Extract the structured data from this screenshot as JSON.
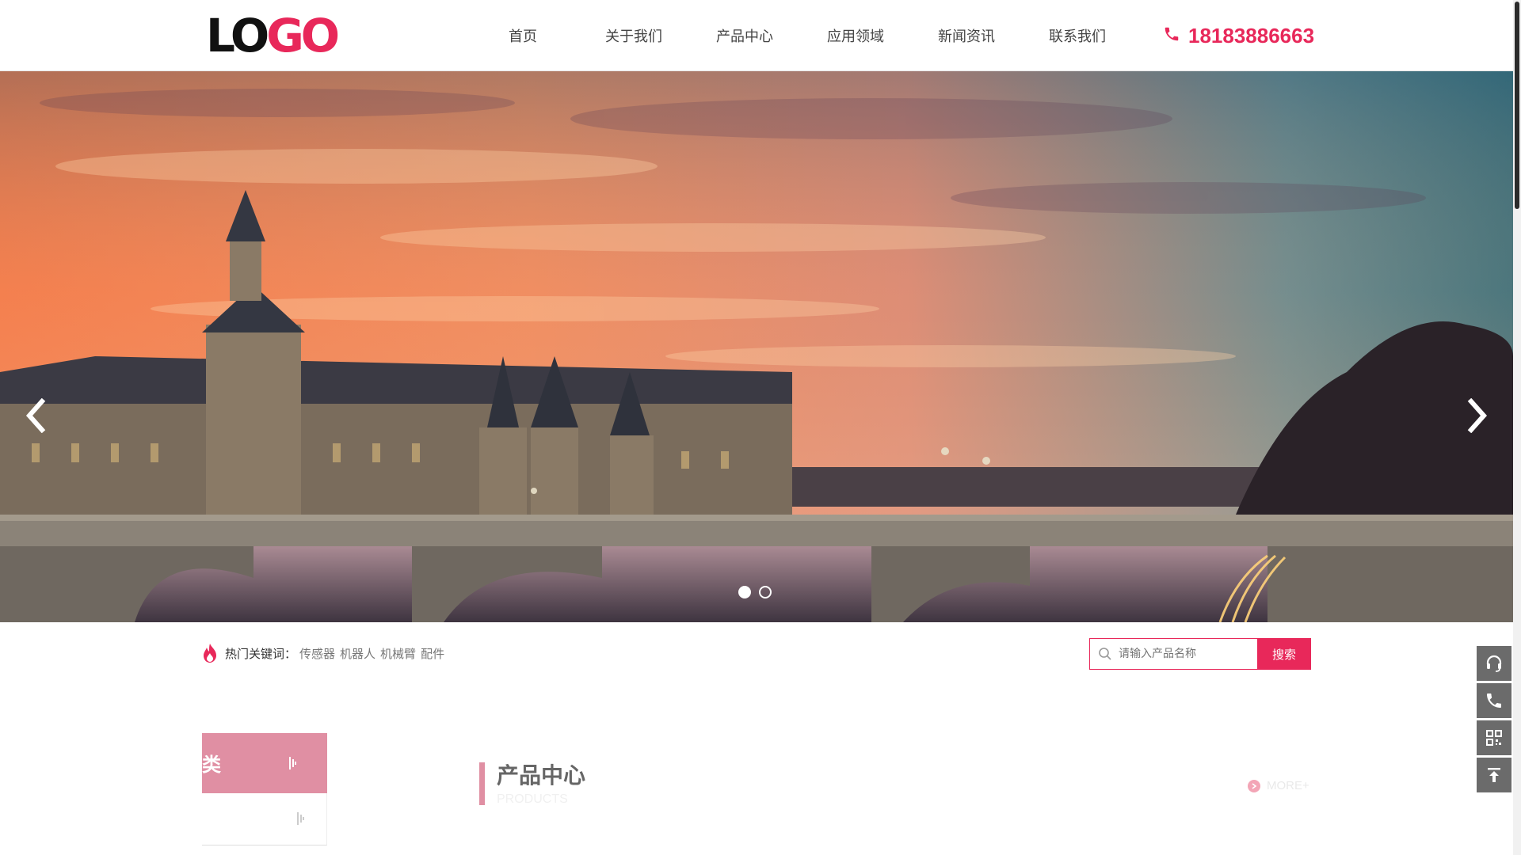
{
  "header": {
    "logo": {
      "part1": "LO",
      "part2": "GO"
    },
    "nav": [
      {
        "label": "首页"
      },
      {
        "label": "关于我们"
      },
      {
        "label": "产品中心"
      },
      {
        "label": "应用领域"
      },
      {
        "label": "新闻资讯"
      },
      {
        "label": "联系我们"
      }
    ],
    "phone": "18183886663"
  },
  "banner": {
    "prev_icon": "chevron-left-icon",
    "next_icon": "chevron-right-icon",
    "slide_count": 2,
    "active_slide": 1
  },
  "hot_keywords": {
    "label": "热门关键词：",
    "items": [
      "传感器",
      "机器人",
      "机械臂",
      "配件"
    ]
  },
  "search": {
    "placeholder": "请输入产品名称",
    "button_label": "搜索"
  },
  "side_tools": [
    "headset-icon",
    "phone-icon",
    "qrcode-icon",
    "back-to-top-icon"
  ],
  "categories": {
    "title": "类"
  },
  "products": {
    "title": "产品中心",
    "subtitle": "PRODUCTS",
    "more_label": "MORE+"
  },
  "colors": {
    "accent": "#e8285a",
    "accent_soft": "#e08fa3",
    "side_tool_bg": "#6b6b6b"
  }
}
